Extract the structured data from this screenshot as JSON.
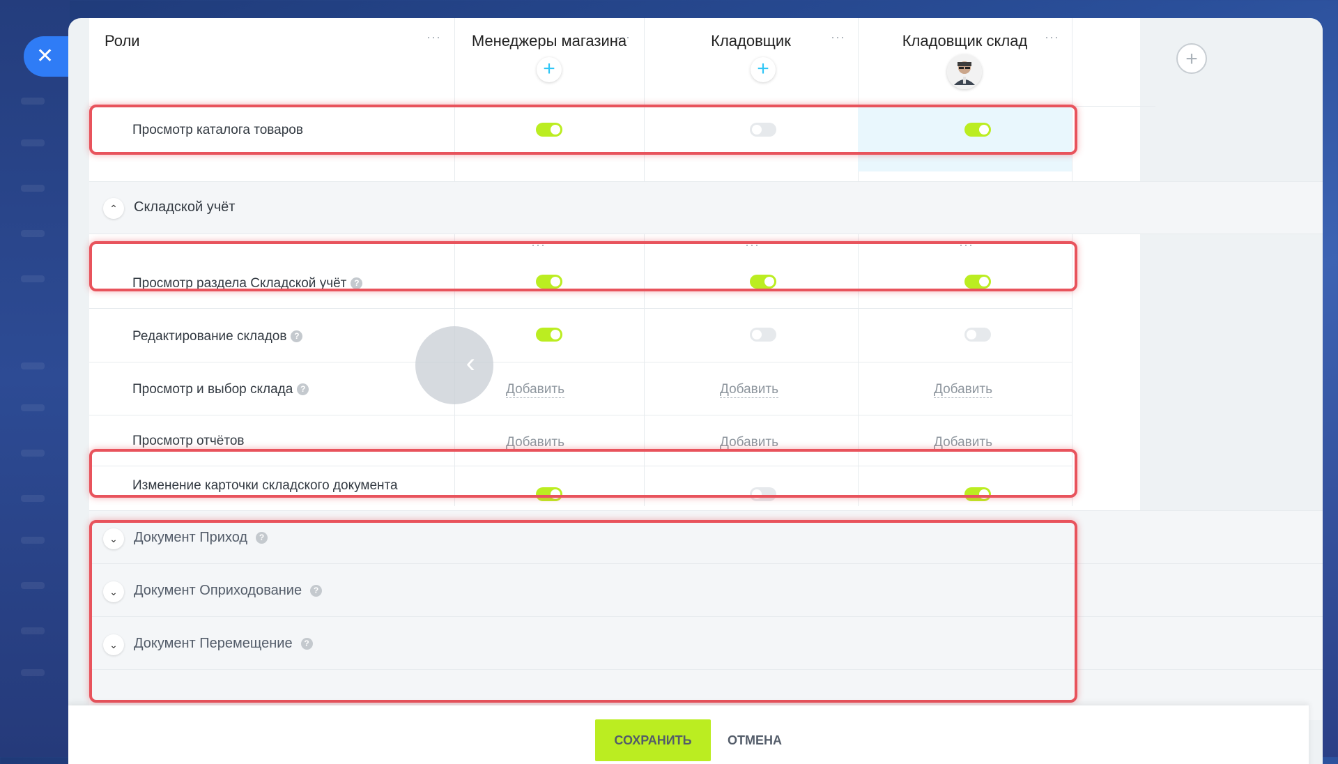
{
  "header": {
    "roles_label": "Роли",
    "columns": [
      {
        "title": "Менеджеры магазина"
      },
      {
        "title": "Кладовщик"
      },
      {
        "title": "Кладовщик склад"
      }
    ]
  },
  "rows_top": [
    {
      "label": "Просмотр каталога товаров",
      "toggles": [
        "on",
        "off",
        "on"
      ]
    }
  ],
  "section_stock": {
    "title": "Складской учёт"
  },
  "rows_stock": [
    {
      "label": "Просмотр раздела Складской учёт",
      "help": true,
      "toggles": [
        "on",
        "on",
        "on"
      ]
    },
    {
      "label": "Редактирование складов",
      "help": true,
      "toggles": [
        "on",
        "off",
        "off"
      ]
    },
    {
      "label": "Просмотр и выбор склада",
      "help": true,
      "add_label": "Добавить"
    },
    {
      "label": "Просмотр отчётов",
      "help": false,
      "add_label": "Добавить"
    },
    {
      "label": "Изменение карточки складского документа",
      "help": false,
      "toggles": [
        "on",
        "off",
        "on"
      ]
    }
  ],
  "collapsed_sections": [
    {
      "title": "Документ Приход"
    },
    {
      "title": "Документ Оприходование"
    },
    {
      "title": "Документ Перемещение"
    }
  ],
  "footer": {
    "save_label": "СОХРАНИТЬ",
    "cancel_label": "ОТМЕНА"
  },
  "colors": {
    "toggle_on": "#bbed21",
    "toggle_off": "#e6e9ec",
    "highlight": "#e8535c",
    "accent_blue": "#2f7cf6"
  }
}
